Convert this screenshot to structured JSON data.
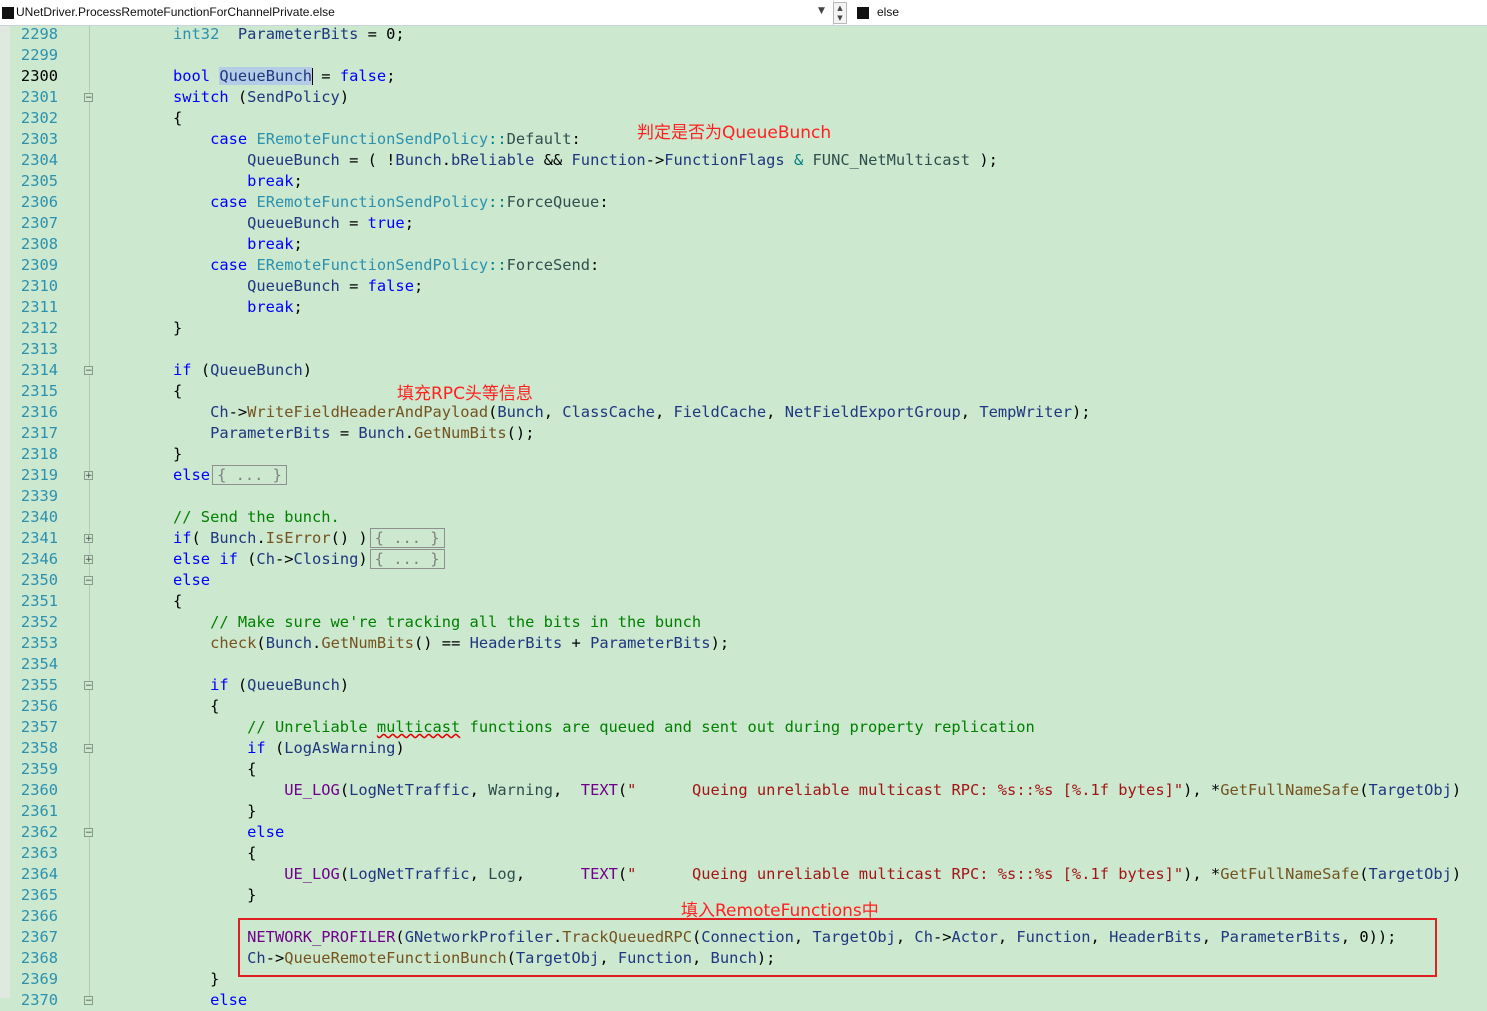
{
  "navbar": {
    "scope": "UNetDriver.ProcessRemoteFunctionForChannelPrivate.else",
    "member": "else"
  },
  "annotations": {
    "a1": "判定是否为QueueBunch",
    "a2": "填充RPC头等信息",
    "a3": "填入RemoteFunctions中"
  },
  "lines": [
    {
      "num": "2298",
      "tokens": [
        [
          "ty",
          "int32"
        ],
        [
          "",
          "  "
        ],
        [
          "vr",
          "ParameterBits"
        ],
        [
          "",
          " = 0;"
        ]
      ]
    },
    {
      "num": "2299",
      "tokens": []
    },
    {
      "num": "2300",
      "tokens": [
        [
          "kw",
          "bool"
        ],
        [
          "",
          " "
        ],
        [
          "hlvr",
          "QueueBunch"
        ],
        [
          "caret",
          ""
        ],
        [
          "",
          " = "
        ],
        [
          "kw",
          "false"
        ],
        [
          "",
          ";"
        ]
      ]
    },
    {
      "num": "2301",
      "tokens": [
        [
          "kw",
          "switch"
        ],
        [
          "",
          " ("
        ],
        [
          "vr",
          "SendPolicy"
        ],
        [
          "",
          ")"
        ]
      ]
    },
    {
      "num": "2302",
      "tokens": [
        [
          "",
          "{"
        ]
      ]
    },
    {
      "num": "2303",
      "tokens": [
        [
          "",
          "    "
        ],
        [
          "kw",
          "case"
        ],
        [
          "",
          " "
        ],
        [
          "ty",
          "ERemoteFunctionSendPolicy"
        ],
        [
          "col",
          "::"
        ],
        [
          "en",
          "Default"
        ],
        [
          "",
          ":"
        ]
      ]
    },
    {
      "num": "2304",
      "tokens": [
        [
          "",
          "        "
        ],
        [
          "vr",
          "QueueBunch"
        ],
        [
          "",
          " = ( !"
        ],
        [
          "vr",
          "Bunch"
        ],
        [
          "",
          "."
        ],
        [
          "vr",
          "bReliable"
        ],
        [
          "",
          " && "
        ],
        [
          "vr",
          "Function"
        ],
        [
          "",
          "->"
        ],
        [
          "vr",
          "FunctionFlags"
        ],
        [
          "",
          " "
        ],
        [
          "col",
          "&"
        ],
        [
          "",
          " "
        ],
        [
          "en",
          "FUNC_NetMulticast"
        ],
        [
          "",
          " );"
        ]
      ]
    },
    {
      "num": "2305",
      "tokens": [
        [
          "",
          "        "
        ],
        [
          "kw",
          "break"
        ],
        [
          "",
          ";"
        ]
      ]
    },
    {
      "num": "2306",
      "tokens": [
        [
          "",
          "    "
        ],
        [
          "kw",
          "case"
        ],
        [
          "",
          " "
        ],
        [
          "ty",
          "ERemoteFunctionSendPolicy"
        ],
        [
          "col",
          "::"
        ],
        [
          "en",
          "ForceQueue"
        ],
        [
          "",
          ":"
        ]
      ]
    },
    {
      "num": "2307",
      "tokens": [
        [
          "",
          "        "
        ],
        [
          "vr",
          "QueueBunch"
        ],
        [
          "",
          " = "
        ],
        [
          "kw",
          "true"
        ],
        [
          "",
          ";"
        ]
      ]
    },
    {
      "num": "2308",
      "tokens": [
        [
          "",
          "        "
        ],
        [
          "kw",
          "break"
        ],
        [
          "",
          ";"
        ]
      ]
    },
    {
      "num": "2309",
      "tokens": [
        [
          "",
          "    "
        ],
        [
          "kw",
          "case"
        ],
        [
          "",
          " "
        ],
        [
          "ty",
          "ERemoteFunctionSendPolicy"
        ],
        [
          "col",
          "::"
        ],
        [
          "en",
          "ForceSend"
        ],
        [
          "",
          ":"
        ]
      ]
    },
    {
      "num": "2310",
      "tokens": [
        [
          "",
          "        "
        ],
        [
          "vr",
          "QueueBunch"
        ],
        [
          "",
          " = "
        ],
        [
          "kw",
          "false"
        ],
        [
          "",
          ";"
        ]
      ]
    },
    {
      "num": "2311",
      "tokens": [
        [
          "",
          "        "
        ],
        [
          "kw",
          "break"
        ],
        [
          "",
          ";"
        ]
      ]
    },
    {
      "num": "2312",
      "tokens": [
        [
          "",
          "}"
        ]
      ]
    },
    {
      "num": "2313",
      "tokens": []
    },
    {
      "num": "2314",
      "tokens": [
        [
          "kw",
          "if"
        ],
        [
          "",
          " ("
        ],
        [
          "vr",
          "QueueBunch"
        ],
        [
          "",
          ")"
        ]
      ]
    },
    {
      "num": "2315",
      "tokens": [
        [
          "",
          "{"
        ]
      ]
    },
    {
      "num": "2316",
      "tokens": [
        [
          "",
          "    "
        ],
        [
          "vr",
          "Ch"
        ],
        [
          "",
          "->"
        ],
        [
          "fn",
          "WriteFieldHeaderAndPayload"
        ],
        [
          "",
          "("
        ],
        [
          "vr",
          "Bunch"
        ],
        [
          "",
          ", "
        ],
        [
          "vr",
          "ClassCache"
        ],
        [
          "",
          ", "
        ],
        [
          "vr",
          "FieldCache"
        ],
        [
          "",
          ", "
        ],
        [
          "vr",
          "NetFieldExportGroup"
        ],
        [
          "",
          ", "
        ],
        [
          "vr",
          "TempWriter"
        ],
        [
          "",
          ");"
        ]
      ]
    },
    {
      "num": "2317",
      "tokens": [
        [
          "",
          "    "
        ],
        [
          "vr",
          "ParameterBits"
        ],
        [
          "",
          " = "
        ],
        [
          "vr",
          "Bunch"
        ],
        [
          "",
          "."
        ],
        [
          "fn",
          "GetNumBits"
        ],
        [
          "",
          "();"
        ]
      ]
    },
    {
      "num": "2318",
      "tokens": [
        [
          "",
          "}"
        ]
      ]
    },
    {
      "num": "2319",
      "tokens": [
        [
          "kw",
          "else"
        ],
        [
          "box",
          "{ ... }"
        ]
      ]
    },
    {
      "num": "2339",
      "tokens": []
    },
    {
      "num": "2340",
      "tokens": [
        [
          "cm",
          "// Send the bunch."
        ]
      ]
    },
    {
      "num": "2341",
      "tokens": [
        [
          "kw",
          "if"
        ],
        [
          "",
          "( "
        ],
        [
          "vr",
          "Bunch"
        ],
        [
          "",
          "."
        ],
        [
          "fn",
          "IsError"
        ],
        [
          "",
          "() )"
        ],
        [
          "box",
          "{ ... }"
        ]
      ]
    },
    {
      "num": "2346",
      "tokens": [
        [
          "kw",
          "else if"
        ],
        [
          "",
          " ("
        ],
        [
          "vr",
          "Ch"
        ],
        [
          "",
          "->"
        ],
        [
          "vr",
          "Closing"
        ],
        [
          "",
          ")"
        ],
        [
          "box",
          "{ ... }"
        ]
      ]
    },
    {
      "num": "2350",
      "tokens": [
        [
          "kw",
          "else"
        ]
      ]
    },
    {
      "num": "2351",
      "tokens": [
        [
          "",
          "{"
        ]
      ]
    },
    {
      "num": "2352",
      "tokens": [
        [
          "",
          "    "
        ],
        [
          "cm",
          "// Make sure we're tracking all the bits in the bunch"
        ]
      ]
    },
    {
      "num": "2353",
      "tokens": [
        [
          "",
          "    "
        ],
        [
          "fn",
          "check"
        ],
        [
          "",
          "("
        ],
        [
          "vr",
          "Bunch"
        ],
        [
          "",
          "."
        ],
        [
          "fn",
          "GetNumBits"
        ],
        [
          "",
          "() == "
        ],
        [
          "vr",
          "HeaderBits"
        ],
        [
          "",
          " + "
        ],
        [
          "vr",
          "ParameterBits"
        ],
        [
          "",
          ");"
        ]
      ]
    },
    {
      "num": "2354",
      "tokens": []
    },
    {
      "num": "2355",
      "tokens": [
        [
          "",
          "    "
        ],
        [
          "kw",
          "if"
        ],
        [
          "",
          " ("
        ],
        [
          "vr",
          "QueueBunch"
        ],
        [
          "",
          ")"
        ]
      ]
    },
    {
      "num": "2356",
      "tokens": [
        [
          "",
          "    {"
        ]
      ]
    },
    {
      "num": "2357",
      "tokens": [
        [
          "",
          "        "
        ],
        [
          "cm",
          "// Unreliable "
        ],
        [
          "cmsq",
          "multicast"
        ],
        [
          "cm",
          " functions are queued and sent out during property replication"
        ]
      ]
    },
    {
      "num": "2358",
      "tokens": [
        [
          "",
          "        "
        ],
        [
          "kw",
          "if"
        ],
        [
          "",
          " ("
        ],
        [
          "vr",
          "LogAsWarning"
        ],
        [
          "",
          ")"
        ]
      ]
    },
    {
      "num": "2359",
      "tokens": [
        [
          "",
          "        {"
        ]
      ]
    },
    {
      "num": "2360",
      "tokens": [
        [
          "",
          "            "
        ],
        [
          "mc",
          "UE_LOG"
        ],
        [
          "",
          "("
        ],
        [
          "vr",
          "LogNetTraffic"
        ],
        [
          "",
          ", "
        ],
        [
          "en",
          "Warning"
        ],
        [
          "",
          ",  "
        ],
        [
          "mc",
          "TEXT"
        ],
        [
          "",
          "("
        ],
        [
          "st",
          "\"      Queing unreliable multicast RPC: %s::%s [%.1f bytes]\""
        ],
        [
          "",
          "), *"
        ],
        [
          "fn",
          "GetFullNameSafe"
        ],
        [
          "",
          "("
        ],
        [
          "vr",
          "TargetObj"
        ],
        [
          "",
          ")"
        ]
      ]
    },
    {
      "num": "2361",
      "tokens": [
        [
          "",
          "        }"
        ]
      ]
    },
    {
      "num": "2362",
      "tokens": [
        [
          "",
          "        "
        ],
        [
          "kw",
          "else"
        ]
      ]
    },
    {
      "num": "2363",
      "tokens": [
        [
          "",
          "        {"
        ]
      ]
    },
    {
      "num": "2364",
      "tokens": [
        [
          "",
          "            "
        ],
        [
          "mc",
          "UE_LOG"
        ],
        [
          "",
          "("
        ],
        [
          "vr",
          "LogNetTraffic"
        ],
        [
          "",
          ", "
        ],
        [
          "en",
          "Log"
        ],
        [
          "",
          ",      "
        ],
        [
          "mc",
          "TEXT"
        ],
        [
          "",
          "("
        ],
        [
          "st",
          "\"      Queing unreliable multicast RPC: %s::%s [%.1f bytes]\""
        ],
        [
          "",
          "), *"
        ],
        [
          "fn",
          "GetFullNameSafe"
        ],
        [
          "",
          "("
        ],
        [
          "vr",
          "TargetObj"
        ],
        [
          "",
          ")"
        ]
      ]
    },
    {
      "num": "2365",
      "tokens": [
        [
          "",
          "        }"
        ]
      ]
    },
    {
      "num": "2366",
      "tokens": []
    },
    {
      "num": "2367",
      "tokens": [
        [
          "",
          "        "
        ],
        [
          "mc",
          "NETWORK_PROFILER"
        ],
        [
          "",
          "("
        ],
        [
          "vr",
          "GNetworkProfiler"
        ],
        [
          "",
          "."
        ],
        [
          "fn",
          "TrackQueuedRPC"
        ],
        [
          "",
          "("
        ],
        [
          "vr",
          "Connection"
        ],
        [
          "",
          ", "
        ],
        [
          "vr",
          "TargetObj"
        ],
        [
          "",
          ", "
        ],
        [
          "vr",
          "Ch"
        ],
        [
          "",
          "->"
        ],
        [
          "vr",
          "Actor"
        ],
        [
          "",
          ", "
        ],
        [
          "vr",
          "Function"
        ],
        [
          "",
          ", "
        ],
        [
          "vr",
          "HeaderBits"
        ],
        [
          "",
          ", "
        ],
        [
          "vr",
          "ParameterBits"
        ],
        [
          "",
          ", 0));"
        ]
      ]
    },
    {
      "num": "2368",
      "tokens": [
        [
          "",
          "        "
        ],
        [
          "vr",
          "Ch"
        ],
        [
          "",
          "->"
        ],
        [
          "fn",
          "QueueRemoteFunctionBunch"
        ],
        [
          "",
          "("
        ],
        [
          "vr",
          "TargetObj"
        ],
        [
          "",
          ", "
        ],
        [
          "vr",
          "Function"
        ],
        [
          "",
          ", "
        ],
        [
          "vr",
          "Bunch"
        ],
        [
          "",
          ");"
        ]
      ]
    },
    {
      "num": "2369",
      "tokens": [
        [
          "",
          "    }"
        ]
      ]
    },
    {
      "num": "2370",
      "tokens": [
        [
          "",
          "    "
        ],
        [
          "kw",
          "else"
        ]
      ]
    }
  ],
  "current_line": "2300",
  "fold_markers": {
    "2301": "−",
    "2314": "−",
    "2319": "+",
    "2341": "+",
    "2346": "+",
    "2350": "−",
    "2355": "−",
    "2358": "−",
    "2362": "−",
    "2370": "−"
  }
}
